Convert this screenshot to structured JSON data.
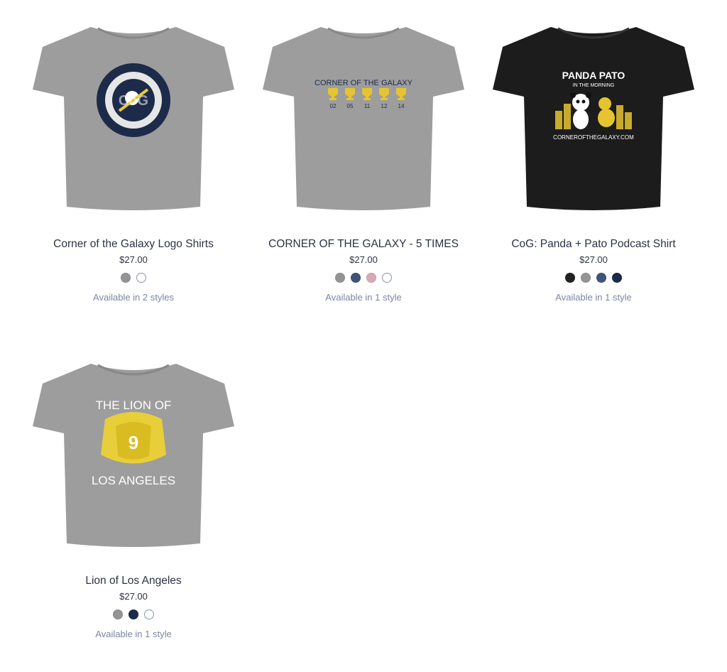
{
  "products": [
    {
      "title": "Corner of the Galaxy Logo Shirts",
      "price": "$27.00",
      "styles": "Available in 2 styles",
      "shirt_color": "#9d9d9d",
      "swatches": [
        "#949494",
        "#ffffff"
      ],
      "design": "circular-crest-logo",
      "design_text": "CoG"
    },
    {
      "title": "CORNER OF THE GALAXY - 5 TIMES",
      "price": "$27.00",
      "styles": "Available in 1 style",
      "shirt_color": "#9d9d9d",
      "swatches": [
        "#949494",
        "#3f5478",
        "#d8a9b8",
        "#ffffff"
      ],
      "design": "trophies-logo",
      "design_text": "CORNER OF THE GALAXY",
      "design_years": [
        "02",
        "05",
        "11",
        "12",
        "14"
      ]
    },
    {
      "title": "CoG: Panda + Pato Podcast Shirt",
      "price": "$27.00",
      "styles": "Available in 1 style",
      "shirt_color": "#1c1c1c",
      "swatches": [
        "#222222",
        "#949494",
        "#3f5478",
        "#1d2b4a"
      ],
      "design": "panda-duck-podcast",
      "design_text": "PANDA PATO",
      "design_subtext": "IN THE MORNING",
      "design_url": "CORNEROFTHEGALAXY.COM"
    },
    {
      "title": "Lion of Los Angeles",
      "price": "$27.00",
      "styles": "Available in 1 style",
      "shirt_color": "#9d9d9d",
      "swatches": [
        "#949494",
        "#1d2b4a",
        "#ffffff"
      ],
      "design": "lion-head",
      "design_text": "THE LION OF",
      "design_subtext": "LOS ANGELES",
      "design_number": "9"
    }
  ]
}
